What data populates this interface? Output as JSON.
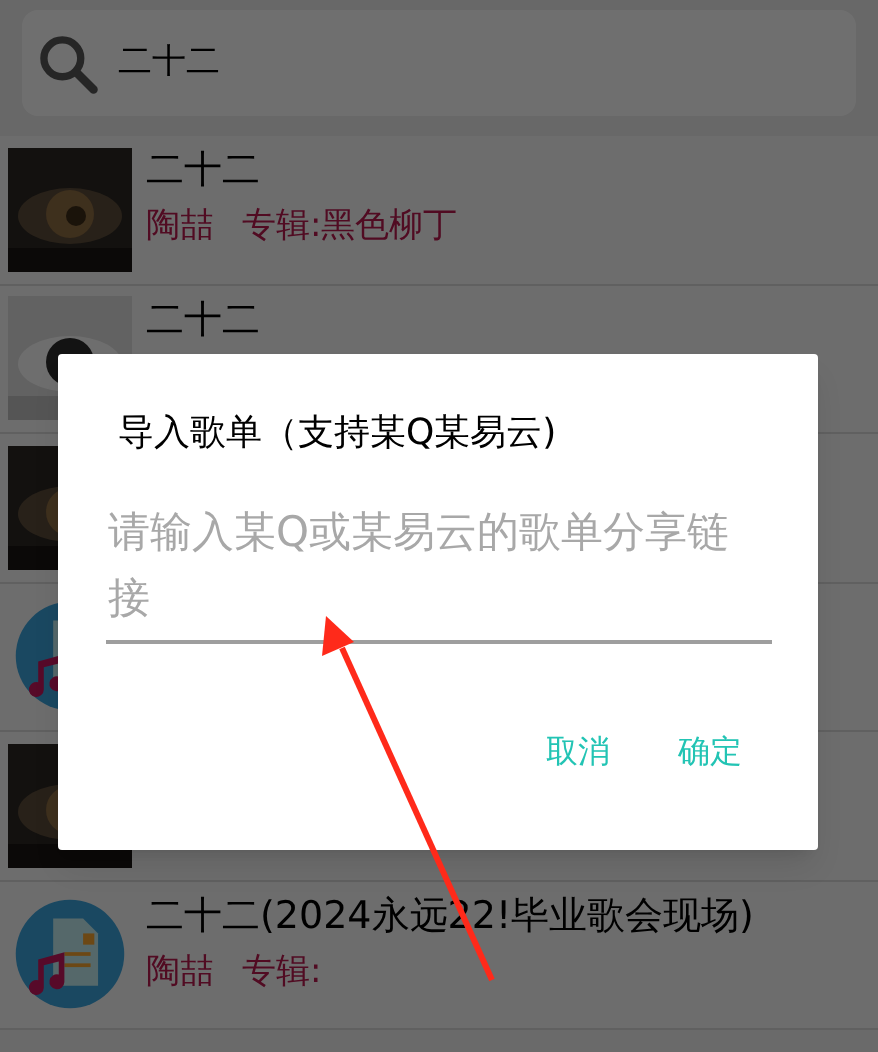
{
  "search": {
    "value": "二十二"
  },
  "songs": [
    {
      "kind": "picture",
      "title": "二十二",
      "artist": "陶喆",
      "album": "专辑:黑色柳丁"
    },
    {
      "kind": "picture",
      "title": "二十二"
    },
    {
      "kind": "picture"
    },
    {
      "kind": "music-file"
    },
    {
      "kind": "picture"
    },
    {
      "kind": "music-file",
      "title": "二十二(2024永远22!毕业歌会现场)",
      "artist": "陶喆",
      "album": "专辑:"
    }
  ],
  "dialog": {
    "title": "导入歌单（支持某Q某易云)",
    "placeholder": "请输入某Q或某易云的歌单分享链接",
    "buttons": [
      "取消",
      "确定"
    ]
  }
}
